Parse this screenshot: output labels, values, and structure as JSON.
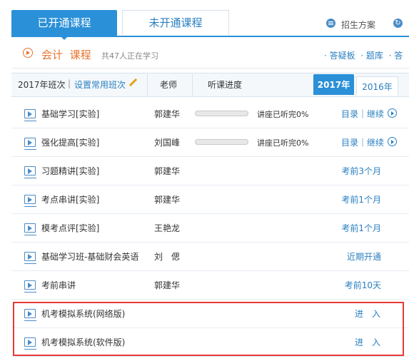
{
  "tabs": {
    "active": "已开通课程",
    "inactive": "未开通课程"
  },
  "top_links": {
    "plan": "招生方案",
    "plan_icon": "list-icon",
    "refresh_icon": "refresh-icon"
  },
  "course": {
    "subject": "会计",
    "label": "课程",
    "learners": "共47人正在学习"
  },
  "course_links": [
    "· 答疑板",
    "· 题库",
    "· 答"
  ],
  "table_header": {
    "year_class": "2017年班次",
    "set_common": "设置常用班次",
    "teacher": "老师",
    "progress": "听课进度",
    "years": [
      "2017年",
      "2016年"
    ]
  },
  "rows": [
    {
      "name": "基础学习[实验]",
      "teacher": "郭建华",
      "progress": 0,
      "status": "讲座已听完0%",
      "action": "目录｜继续",
      "has_play": true
    },
    {
      "name": "强化提高[实验]",
      "teacher": "刘国峰",
      "progress": 0,
      "status": "讲座已听完0%",
      "action": "目录｜继续",
      "has_play": true
    },
    {
      "name": "习题精讲[实验]",
      "teacher": "郭建华",
      "action": "考前3个月"
    },
    {
      "name": "考点串讲[实验]",
      "teacher": "郭建华",
      "action": "考前1个月"
    },
    {
      "name": "模考点评[实验]",
      "teacher": "王艳龙",
      "action": "考前1个月"
    },
    {
      "name": "基础学习班-基础财会英语",
      "teacher": "刘　偲",
      "action": "近期开通"
    },
    {
      "name": "考前串讲",
      "teacher": "郭建华",
      "action": "考前10天"
    },
    {
      "name": "机考模拟系统(网络版)",
      "teacher": "",
      "action": "进　入"
    },
    {
      "name": "机考模拟系统(软件版)",
      "teacher": "",
      "action": "进　入"
    }
  ],
  "colors": {
    "accent": "#2a90d8",
    "link": "#2a7fc0",
    "orange": "#e8722e",
    "highlight_box": "#e53935"
  }
}
